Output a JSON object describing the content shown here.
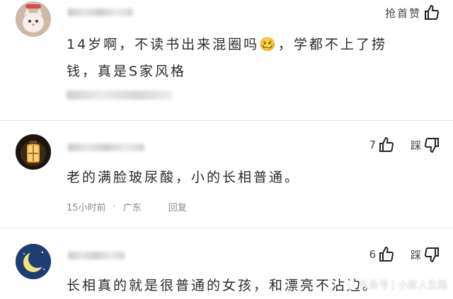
{
  "comments": [
    {
      "content_line1": "14岁啊，不读书出来混圈吗🥴，学都不上了捞",
      "content_line2": "钱，真是S家风格",
      "action_label": "抢首赞",
      "avatar_icon": "cat-avatar"
    },
    {
      "content_line1": "老的满脸玻尿酸，小的长相普通。",
      "time": "15小时前",
      "location": "广东",
      "reply_label": "回复",
      "like_count": "7",
      "dislike_label": "踩",
      "avatar_icon": "lantern-avatar"
    },
    {
      "content_line1": "长相真的就是很普通的女孩，和漂亮不沾边。",
      "like_count": "6",
      "dislike_label": "踩",
      "avatar_icon": "moon-avatar"
    }
  ],
  "watermark": {
    "platform": "头条号",
    "author": "小彦人生路"
  }
}
